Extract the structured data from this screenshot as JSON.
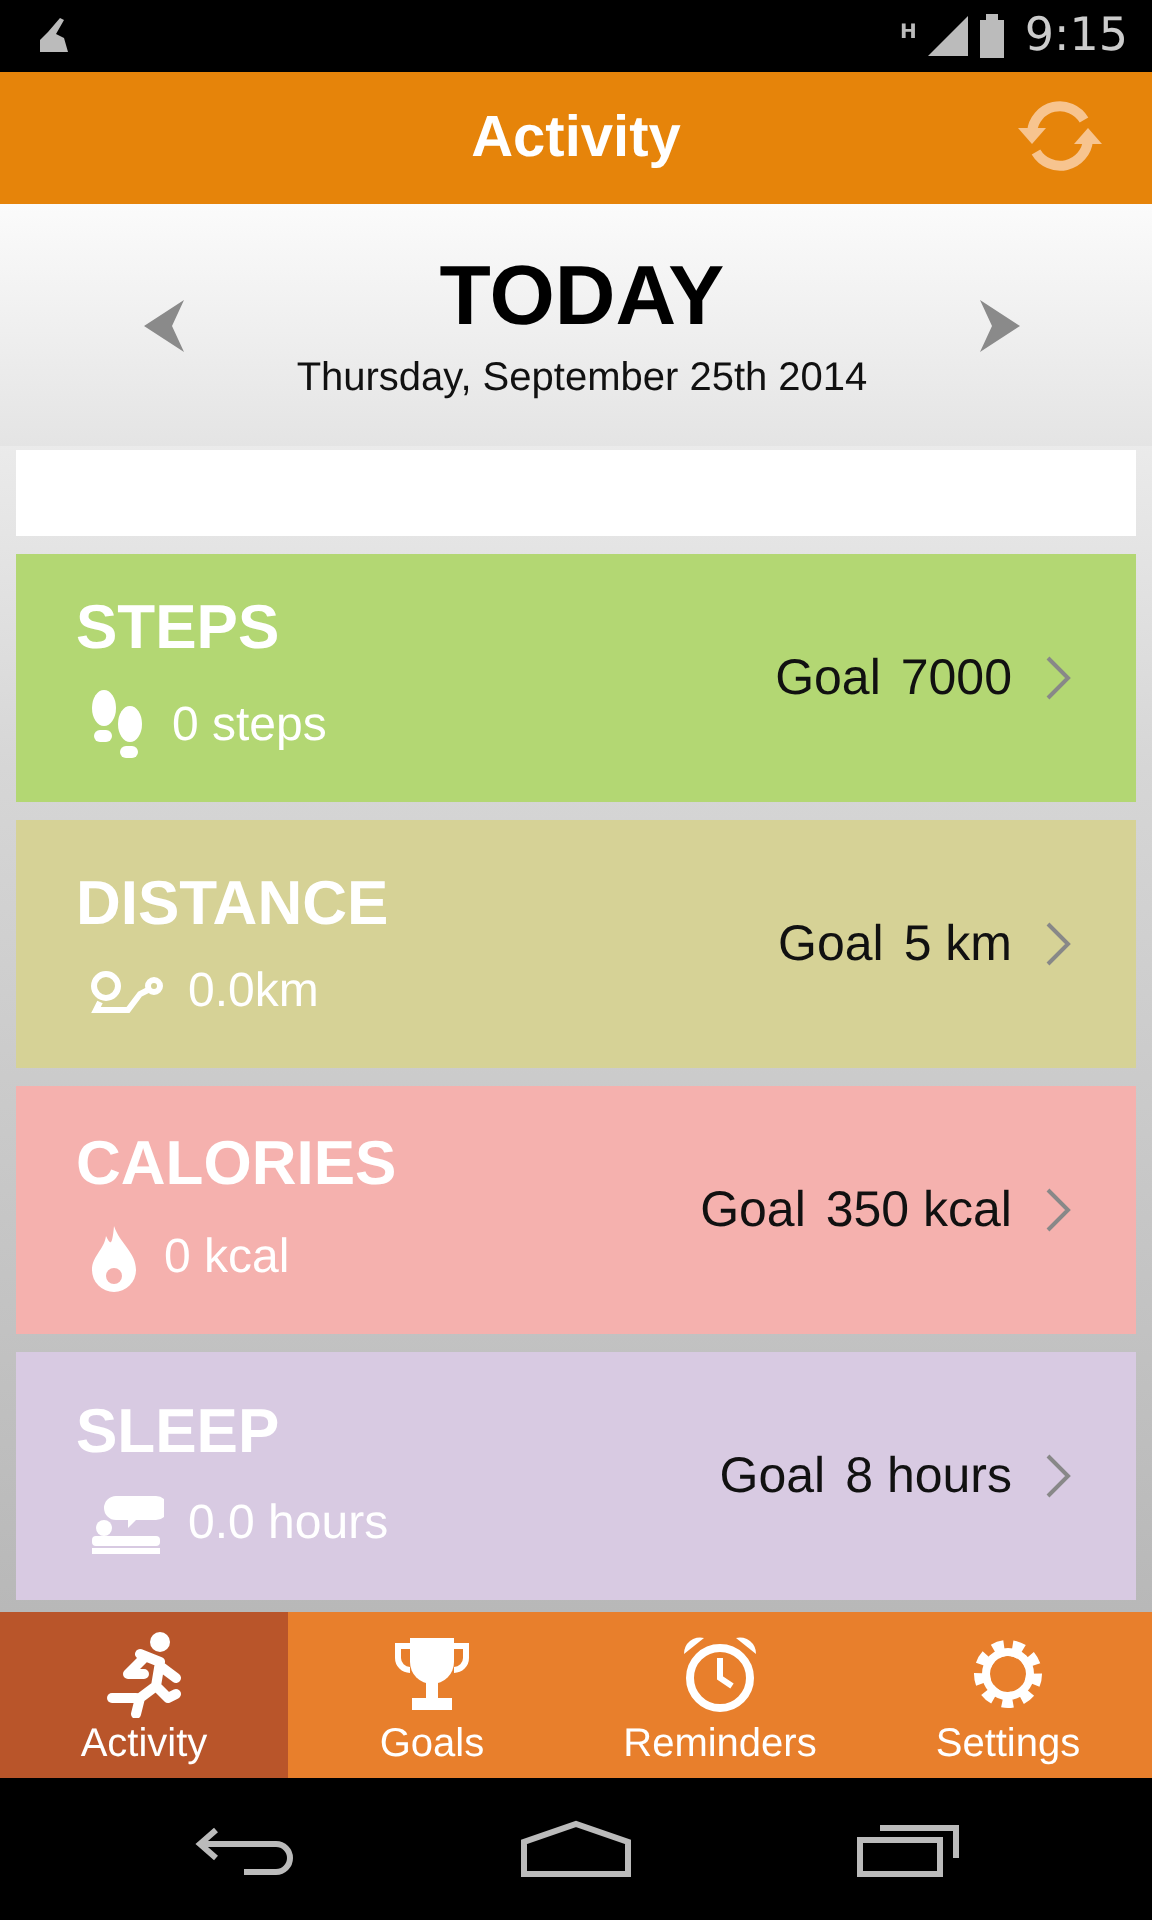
{
  "status_bar": {
    "network": "H",
    "time": "9:15"
  },
  "app_bar": {
    "title": "Activity"
  },
  "date_header": {
    "title": "TODAY",
    "date": "Thursday, September 25th 2014"
  },
  "cards": [
    {
      "kind": "steps",
      "title": "STEPS",
      "value": "0 steps",
      "goal_label": "Goal",
      "goal_value": "7000",
      "color": "#b3d773"
    },
    {
      "kind": "distance",
      "title": "DISTANCE",
      "value": "0.0km",
      "goal_label": "Goal",
      "goal_value": "5 km",
      "color": "#d6d296"
    },
    {
      "kind": "calories",
      "title": "CALORIES",
      "value": "0 kcal",
      "goal_label": "Goal",
      "goal_value": "350 kcal",
      "color": "#f5b1ae"
    },
    {
      "kind": "sleep",
      "title": "SLEEP",
      "value": "0.0 hours",
      "goal_label": "Goal",
      "goal_value": "8 hours",
      "color": "#d8cae2"
    }
  ],
  "bottom_nav": [
    {
      "kind": "activity",
      "label": "Activity",
      "selected": true
    },
    {
      "kind": "goals",
      "label": "Goals",
      "selected": false
    },
    {
      "kind": "reminders",
      "label": "Reminders",
      "selected": false
    },
    {
      "kind": "settings",
      "label": "Settings",
      "selected": false
    }
  ]
}
